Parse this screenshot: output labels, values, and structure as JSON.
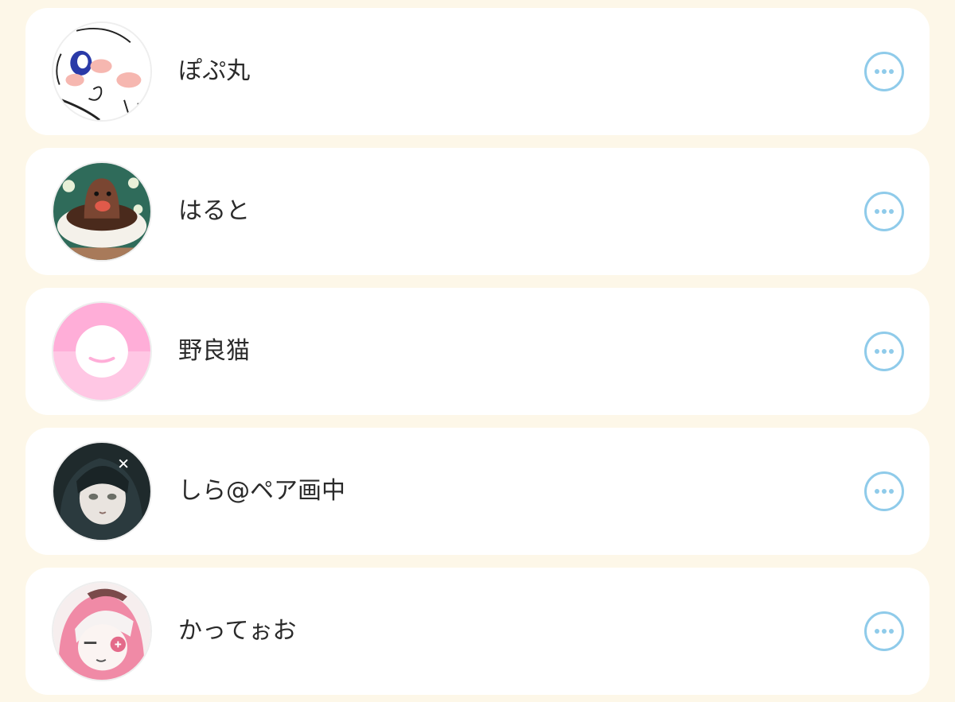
{
  "accent_color": "#8fcbea",
  "users": [
    {
      "name": "ぽぷ丸",
      "avatar_icon": "drawn-face-avatar",
      "more_icon": "more-options-icon"
    },
    {
      "name": "はると",
      "avatar_icon": "mole-plush-avatar",
      "more_icon": "more-options-icon"
    },
    {
      "name": "野良猫",
      "avatar_icon": "default-smile-avatar",
      "more_icon": "more-options-icon"
    },
    {
      "name": "しら@ペア画中",
      "avatar_icon": "anime-girl-dark-avatar",
      "more_icon": "more-options-icon"
    },
    {
      "name": "かってぉお",
      "avatar_icon": "anime-pink-hair-avatar",
      "more_icon": "more-options-icon"
    }
  ]
}
